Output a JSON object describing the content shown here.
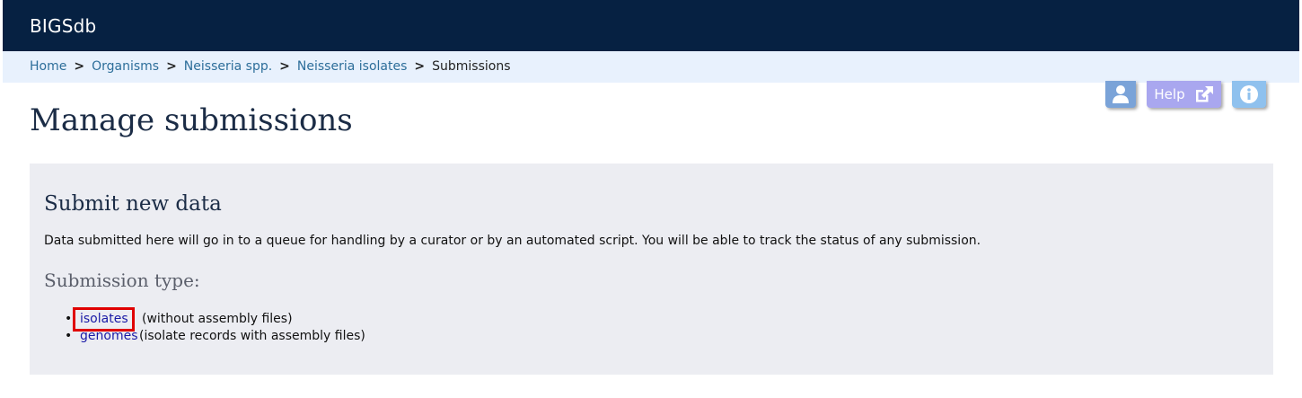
{
  "app": {
    "title": "BIGSdb"
  },
  "breadcrumb": {
    "items": [
      "Home",
      "Organisms",
      "Neisseria spp.",
      "Neisseria isolates"
    ],
    "current": "Submissions",
    "separator": ">"
  },
  "toolbar": {
    "user_icon": "user-icon",
    "help_label": "Help",
    "help_icon": "external-link-icon",
    "info_icon": "info-icon"
  },
  "page": {
    "title": "Manage submissions"
  },
  "submit": {
    "title": "Submit new data",
    "description": "Data submitted here will go in to a queue for handling by a curator or by an automated script. You will be able to track the status of any submission.",
    "type_heading": "Submission type:",
    "types": [
      {
        "link": "isolates",
        "rest": "(without assembly files)"
      },
      {
        "link": "genomes",
        "rest": "(isolate records with assembly files)"
      }
    ]
  },
  "colors": {
    "topbar": "#062142",
    "breadcrumb_bg": "#e8f1fd",
    "link": "#2d6e9a",
    "highlight": "#e00000"
  }
}
